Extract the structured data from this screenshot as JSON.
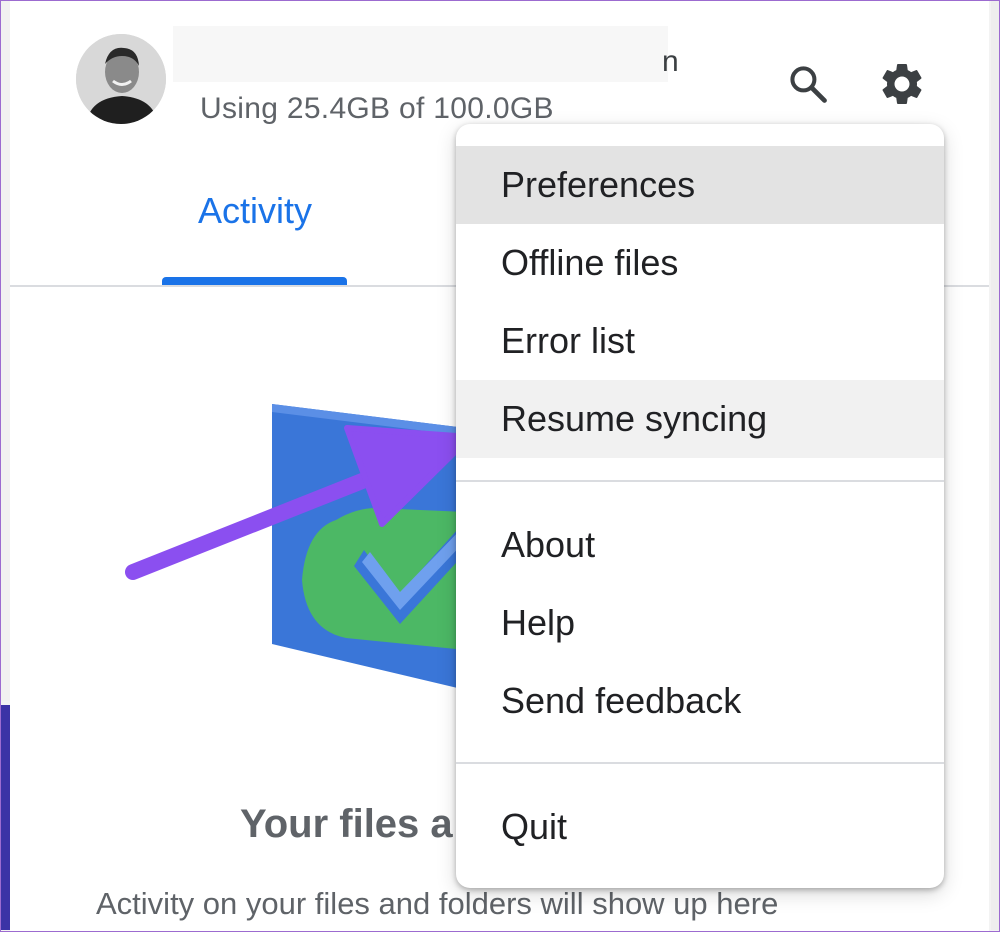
{
  "header": {
    "account_name_visible": "n",
    "storage_text": "Using 25.4GB of 100.0GB"
  },
  "icons": {
    "search": "search-icon",
    "settings": "gear-icon",
    "avatar": "avatar"
  },
  "tabs": [
    {
      "label": "Activity",
      "selected": true
    }
  ],
  "empty_state": {
    "title": "Your files a",
    "body": "Activity on your files and folders will show up here"
  },
  "menu": {
    "items": [
      {
        "label": "Preferences"
      },
      {
        "label": "Offline files"
      },
      {
        "label": "Error list"
      },
      {
        "label": "Resume syncing"
      },
      {
        "label": "About"
      },
      {
        "label": "Help"
      },
      {
        "label": "Send feedback"
      },
      {
        "label": "Quit"
      }
    ]
  },
  "colors": {
    "accent": "#1a73e8",
    "annotation_arrow": "#8b4ff0",
    "illustration_blue": "#3a76d8",
    "illustration_green": "#4cb865"
  }
}
